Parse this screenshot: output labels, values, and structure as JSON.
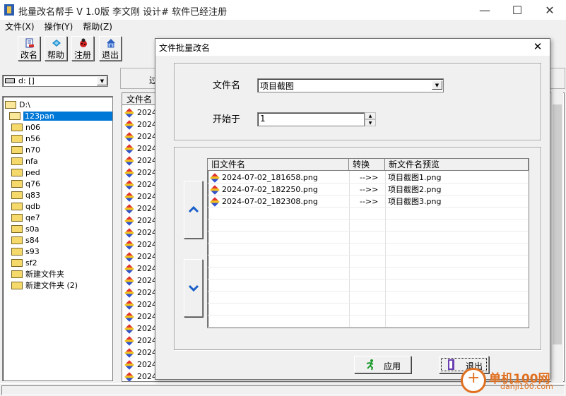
{
  "window": {
    "title": "批量改名帮手  V 1.0版  李文刚 设计# 软件已经注册",
    "minimize": "—",
    "maximize": "☐",
    "close": "✕"
  },
  "menu": [
    "文件(X)",
    "操作(Y)",
    "帮助(Z)"
  ],
  "toolbar": [
    {
      "label": "改名",
      "icon": "rename-icon"
    },
    {
      "label": "帮助",
      "icon": "help-icon"
    },
    {
      "label": "注册",
      "icon": "register-icon"
    },
    {
      "label": "退出",
      "icon": "exit-icon"
    }
  ],
  "drive": {
    "value": "d: []"
  },
  "tree": {
    "root": "D:\\",
    "selected": "123pan",
    "folders": [
      "n06",
      "n56",
      "n70",
      "nfa",
      "ped",
      "q76",
      "q83",
      "qdb",
      "qe7",
      "s0a",
      "s84",
      "s93",
      "sf2",
      "新建文件夹",
      "新建文件夹 (2)"
    ]
  },
  "background_list": {
    "tab_label": "过",
    "header": "文件名",
    "row_prefix": "2024-",
    "row_count": 23
  },
  "dialog": {
    "title": "文件批量改名",
    "close": "✕",
    "filename_label": "文件名",
    "filename_value": "项目截图",
    "start_label": "开始于",
    "start_value": "1",
    "columns": [
      "旧文件名",
      "转换",
      "新文件名预览"
    ],
    "rows": [
      {
        "old": "2024-07-02_181658.png",
        "arrow": "-->>",
        "new": "项目截图1.png"
      },
      {
        "old": "2024-07-02_182250.png",
        "arrow": "-->>",
        "new": "项目截图2.png"
      },
      {
        "old": "2024-07-02_182308.png",
        "arrow": "-->>",
        "new": "项目截图3.png"
      }
    ],
    "apply_label": "应用",
    "exit_label": "退出"
  },
  "watermark": {
    "text": "单机100网",
    "sub": "danji100.com"
  },
  "colors": {
    "selection": "#0078d7",
    "watermark": "#e07020",
    "arrow_blue": "#1a5fc8"
  }
}
